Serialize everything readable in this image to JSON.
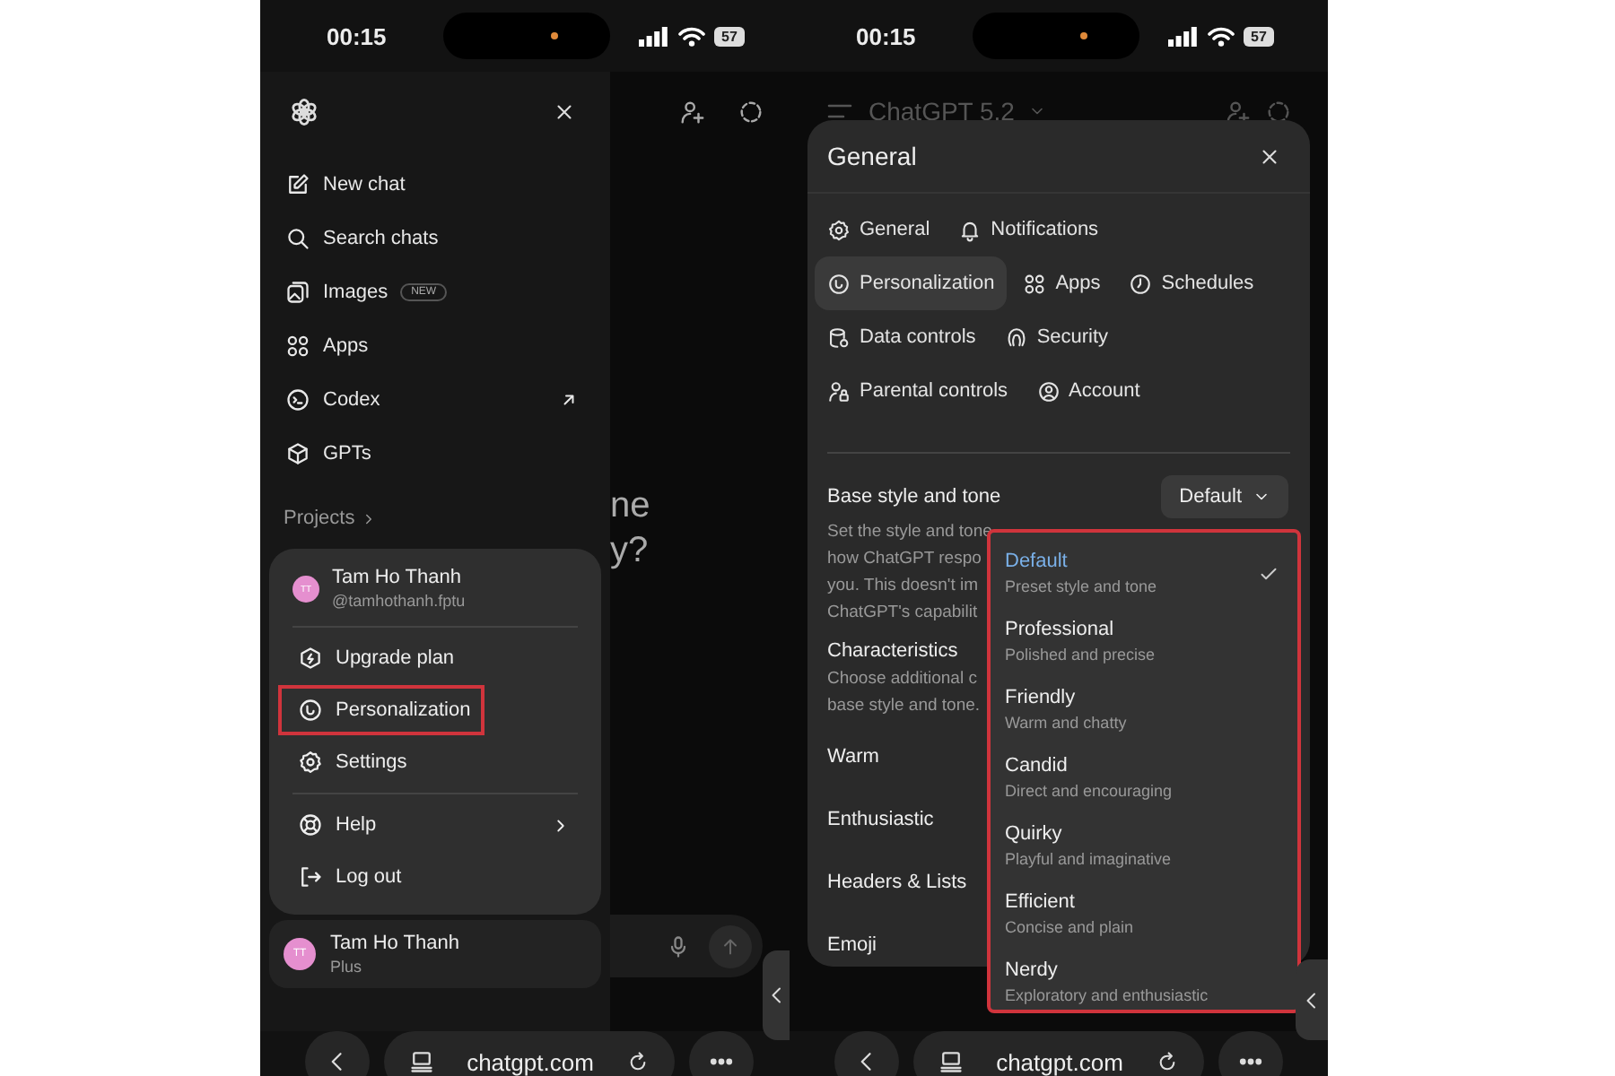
{
  "left_screen": {
    "status_bar": {
      "time": "00:15",
      "battery": "57"
    },
    "sidebar": {
      "items": [
        {
          "label": "New chat",
          "external": false
        },
        {
          "label": "Search chats",
          "external": false
        },
        {
          "label": "Images",
          "badge": "NEW",
          "external": false
        },
        {
          "label": "Apps",
          "external": false
        },
        {
          "label": "Codex",
          "external": true
        },
        {
          "label": "GPTs",
          "external": false
        }
      ],
      "projects": "Projects"
    },
    "account_menu": {
      "name": "Tam Ho Thanh",
      "handle": "@tamhothanh.fptu",
      "initials": "TT",
      "groups": [
        [
          {
            "label": "Upgrade plan",
            "highlighted": false,
            "submenu": false
          },
          {
            "label": "Personalization",
            "highlighted": true,
            "submenu": false
          },
          {
            "label": "Settings",
            "highlighted": false,
            "submenu": false
          }
        ],
        [
          {
            "label": "Help",
            "highlighted": false,
            "submenu": true
          },
          {
            "label": "Log out",
            "highlighted": false,
            "submenu": false
          }
        ]
      ]
    },
    "account_bar": {
      "name": "Tam Ho Thanh",
      "plan": "Plus",
      "initials": "TT"
    },
    "chat_text": [
      "ne",
      "y?"
    ],
    "browser_bar": {
      "url": "chatgpt.com"
    }
  },
  "right_screen": {
    "status_bar": {
      "time": "00:15",
      "battery": "57"
    },
    "header": {
      "title": "ChatGPT 5.2"
    },
    "settings": {
      "title": "General",
      "tab_rows": [
        [
          {
            "label": "General",
            "selected": false
          },
          {
            "label": "Notifications",
            "selected": false
          }
        ],
        [
          {
            "label": "Personalization",
            "selected": true
          },
          {
            "label": "Apps",
            "selected": false
          },
          {
            "label": "Schedules",
            "selected": false
          }
        ],
        [
          {
            "label": "Data controls",
            "selected": false
          },
          {
            "label": "Security",
            "selected": false
          }
        ],
        [
          {
            "label": "Parental controls",
            "selected": false
          },
          {
            "label": "Account",
            "selected": false
          }
        ]
      ],
      "base_style": {
        "label": "Base style and tone",
        "value": "Default",
        "description": [
          "Set the style and tone",
          "how ChatGPT respo",
          "you. This doesn't im",
          "ChatGPT's capabilit"
        ]
      },
      "characteristics": {
        "label": "Characteristics",
        "description": [
          "Choose additional c",
          "base style and tone."
        ]
      },
      "rows": [
        "Warm",
        "Enthusiastic",
        "Headers & Lists",
        "Emoji"
      ]
    },
    "style_menu": {
      "highlighted": true,
      "options": [
        {
          "label": "Default",
          "description": "Preset style and tone",
          "selected": true
        },
        {
          "label": "Professional",
          "description": "Polished and precise",
          "selected": false
        },
        {
          "label": "Friendly",
          "description": "Warm and chatty",
          "selected": false
        },
        {
          "label": "Candid",
          "description": "Direct and encouraging",
          "selected": false
        },
        {
          "label": "Quirky",
          "description": "Playful and imaginative",
          "selected": false
        },
        {
          "label": "Efficient",
          "description": "Concise and plain",
          "selected": false
        },
        {
          "label": "Nerdy",
          "description": "Exploratory and enthusiastic",
          "selected": false
        }
      ]
    },
    "browser_bar": {
      "url": "chatgpt.com"
    }
  }
}
